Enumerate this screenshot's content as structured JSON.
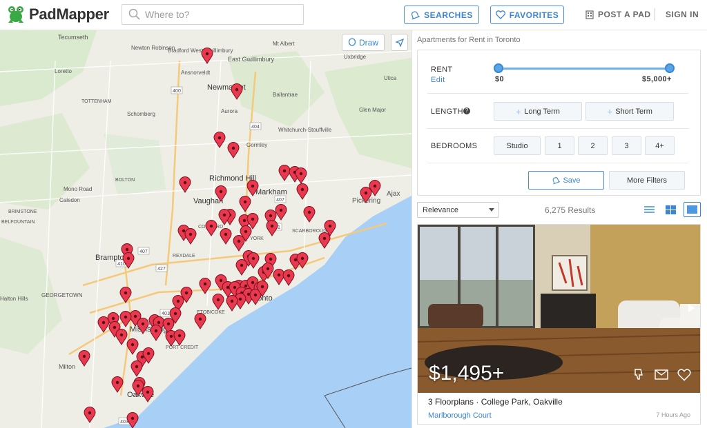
{
  "brand": {
    "name": "PadMapper",
    "icon": "frog-logo-icon"
  },
  "search": {
    "placeholder": "Where to?"
  },
  "header": {
    "searches": "SEARCHES",
    "favorites": "FAVORITES",
    "post": "POST A PAD",
    "signin": "SIGN IN"
  },
  "map": {
    "draw": "Draw",
    "labels": [
      {
        "t": "Tecumseth"
      },
      {
        "t": "Newton Robinson"
      },
      {
        "t": "Bradford West Gwillimbury"
      },
      {
        "t": "Mt Albert"
      },
      {
        "t": "East Gwillimbury"
      },
      {
        "t": "Uxbridge"
      },
      {
        "t": "Ansnorveldt"
      },
      {
        "t": "Utica"
      },
      {
        "t": "Loretto"
      },
      {
        "t": "Newmarket"
      },
      {
        "t": "Ballantrae"
      },
      {
        "t": "TOTTENHAM"
      },
      {
        "t": "Schomberg"
      },
      {
        "t": "Aurora"
      },
      {
        "t": "Glen Major"
      },
      {
        "t": "Whitchurch-Stouffville"
      },
      {
        "t": "Gormley"
      },
      {
        "t": "Richmond Hill"
      },
      {
        "t": "BOLTON"
      },
      {
        "t": "Mono Road"
      },
      {
        "t": "Caledon"
      },
      {
        "t": "Markham"
      },
      {
        "t": "Vaughan"
      },
      {
        "t": "Pickering"
      },
      {
        "t": "Ajax"
      },
      {
        "t": "BRIMSTONE"
      },
      {
        "t": "BELFOUNTAIN"
      },
      {
        "t": "Brampton"
      },
      {
        "t": "SCARBOROUGH"
      },
      {
        "t": "YORK"
      },
      {
        "t": "REXDALE"
      },
      {
        "t": "CONCORD"
      },
      {
        "t": "Halton Hills"
      },
      {
        "t": "GEORGETOWN"
      },
      {
        "t": "Toronto"
      },
      {
        "t": "Mississauga"
      },
      {
        "t": "ETOBICOKE"
      },
      {
        "t": "PORT CREDIT"
      },
      {
        "t": "Milton"
      },
      {
        "t": "Oakville"
      }
    ],
    "highways": [
      "400",
      "404",
      "407",
      "401",
      "410",
      "427",
      "403",
      "410",
      "407",
      "401"
    ]
  },
  "breadcrumb": "Apartments for Rent in Toronto",
  "filters": {
    "rent_label": "RENT",
    "rent_edit": "Edit",
    "rent_min": "$0",
    "rent_max": "$5,000+",
    "length_label": "LENGTH",
    "long_term": "Long Term",
    "short_term": "Short Term",
    "bedrooms_label": "BEDROOMS",
    "bedrooms": [
      "Studio",
      "1",
      "2",
      "3",
      "4+"
    ],
    "save": "Save",
    "more": "More Filters"
  },
  "sort": {
    "selected": "Relevance"
  },
  "results": "6,275 Results",
  "listing": {
    "price": "$1,495+",
    "title": "3 Floorplans · College Park, Oakville",
    "manager": "Marlborough Court",
    "posted": "7 Hours Ago"
  },
  "colors": {
    "accent": "#3a86d4",
    "pin": "#e8394f",
    "water": "#a8cff5",
    "logo": "#3aa845"
  }
}
